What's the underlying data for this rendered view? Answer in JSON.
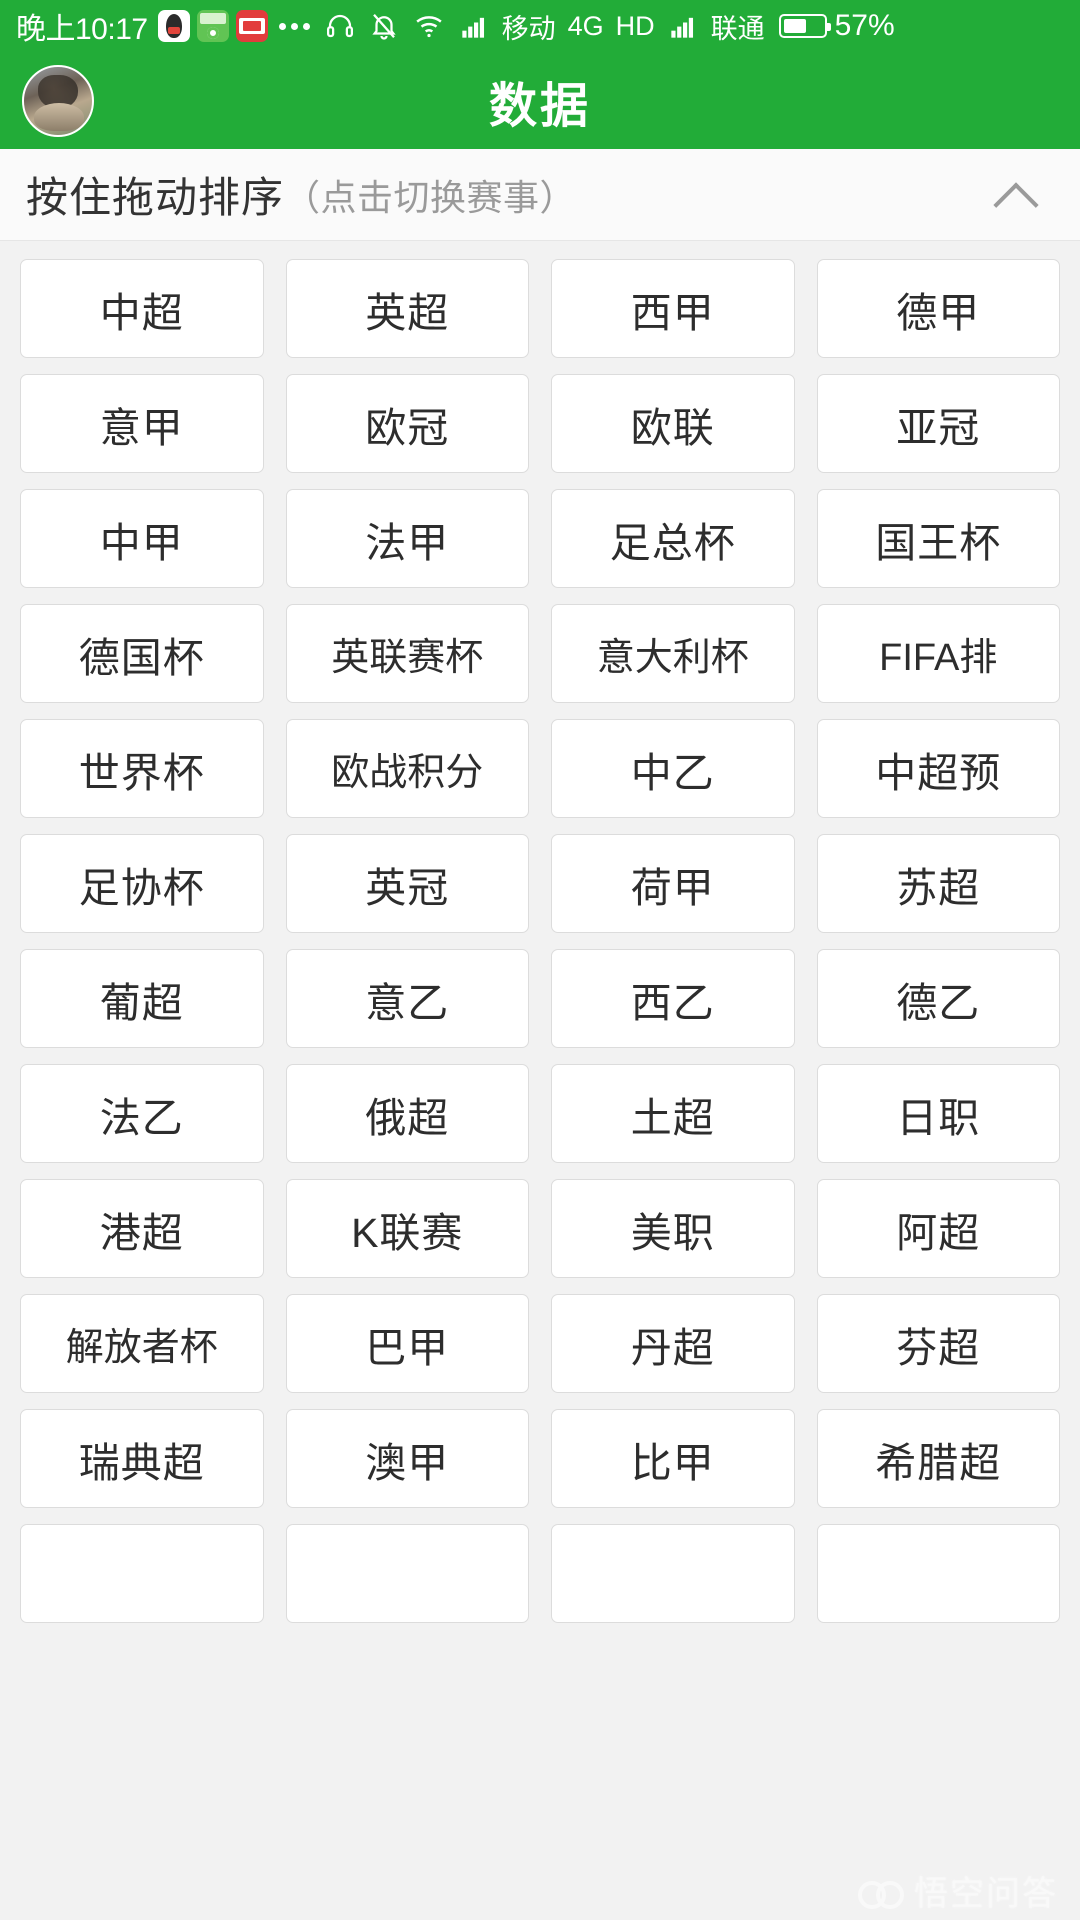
{
  "statusbar": {
    "time": "晚上10:17",
    "app_icons": [
      "qq-icon",
      "wechat-sports-icon",
      "toutiao-icon"
    ],
    "overflow_dots": "more-notifications-icon",
    "headset_icon": "headset-icon",
    "silent_icon": "bell-muted-icon",
    "wifi_icon": "wifi-icon",
    "signal1_icon": "signal-bars-icon",
    "carrier1": "移动",
    "network_type": "4G",
    "hd_label": "HD",
    "signal2_icon": "signal-bars-icon",
    "carrier2": "联通",
    "battery_icon": "battery-icon",
    "battery_percent": "57%"
  },
  "titlebar": {
    "avatar": "user-avatar",
    "title": "数据"
  },
  "section": {
    "main_label": "按住拖动排序",
    "sub_label": "（点击切换赛事）",
    "collapse_icon": "chevron-up-icon"
  },
  "grid": {
    "columns": 4,
    "items": [
      "中超",
      "英超",
      "西甲",
      "德甲",
      "意甲",
      "欧冠",
      "欧联",
      "亚冠",
      "中甲",
      "法甲",
      "足总杯",
      "国王杯",
      "德国杯",
      "英联赛杯",
      "意大利杯",
      "FIFA排",
      "世界杯",
      "欧战积分",
      "中乙",
      "中超预",
      "足协杯",
      "英冠",
      "荷甲",
      "苏超",
      "葡超",
      "意乙",
      "西乙",
      "德乙",
      "法乙",
      "俄超",
      "土超",
      "日职",
      "港超",
      "K联赛",
      "美职",
      "阿超",
      "解放者杯",
      "巴甲",
      "丹超",
      "芬超",
      "瑞典超",
      "澳甲",
      "比甲",
      "希腊超",
      "",
      "",
      "",
      ""
    ]
  },
  "watermark": {
    "text": "悟空问答",
    "logo": "wukong-logo-icon"
  },
  "colors": {
    "brand_green": "#22ac38",
    "page_background": "#f2f2f2",
    "cell_background": "#ffffff",
    "cell_border": "#dcdcdc",
    "primary_text": "#2d2d2d",
    "muted_text": "#9a9a9a"
  }
}
